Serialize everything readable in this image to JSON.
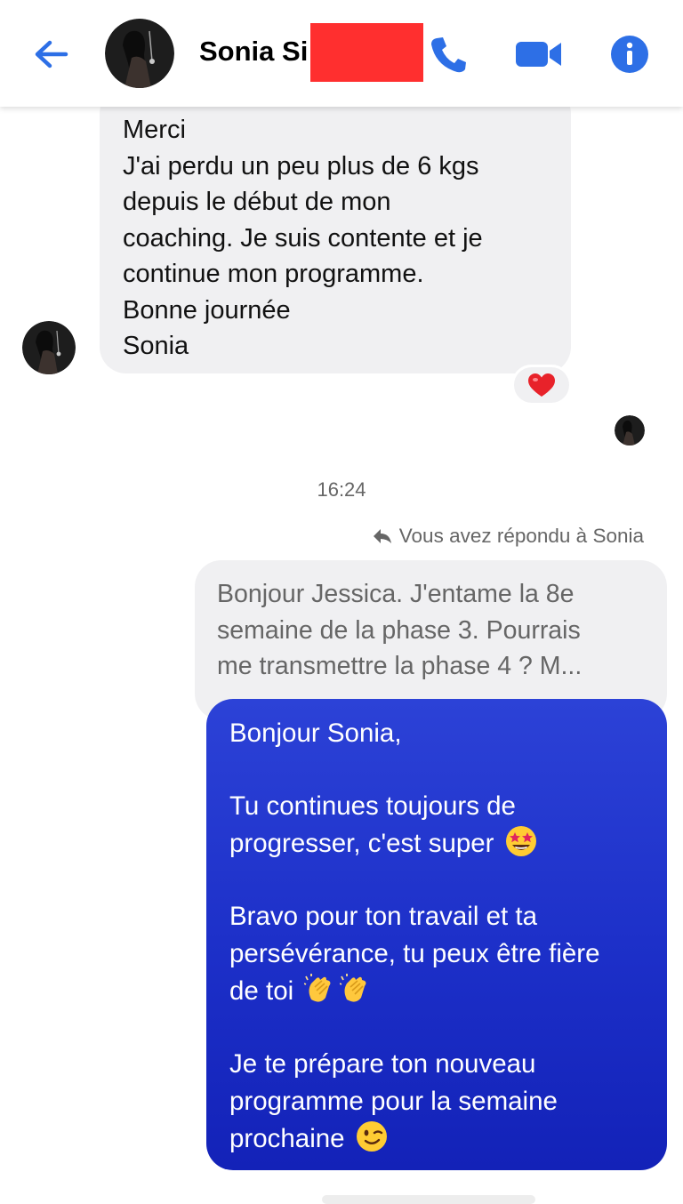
{
  "header": {
    "contact_name": "Sonia Si",
    "icons": [
      "back-arrow-icon",
      "phone-icon",
      "video-camera-icon",
      "info-icon"
    ],
    "accent_color": "#1877f2"
  },
  "incoming_message": {
    "lines": [
      "Merci",
      "J'ai perdu un peu plus de 6 kgs",
      "depuis le début de mon",
      "coaching. Je suis contente et je",
      "continue mon programme.",
      "Bonne journée",
      "Sonia"
    ],
    "reaction": "heart-emoji"
  },
  "timestamp": "16:24",
  "reply_note": "Vous avez répondu à Sonia",
  "quoted_message": {
    "lines": [
      "Bonjour Jessica. J'entame la 8e",
      "semaine de la phase 3. Pourrais",
      "me transmettre la phase 4 ? M..."
    ]
  },
  "outgoing_message": {
    "greeting": "Bonjour Sonia,",
    "p1_line1": "Tu continues toujours de",
    "p1_line2": "progresser, c'est super",
    "p2_line1": "Bravo pour ton travail et ta",
    "p2_line2": "persévérance, tu peux être fière",
    "p2_line3": "de toi",
    "p3_line1": "Je te prépare ton nouveau",
    "p3_line2": "programme pour la semaine",
    "p3_line3": "prochaine",
    "emojis": [
      "star-struck-emoji",
      "clapping-hands-emoji",
      "clapping-hands-emoji",
      "winking-face-emoji"
    ],
    "bubble_color": "#1f33c9"
  }
}
